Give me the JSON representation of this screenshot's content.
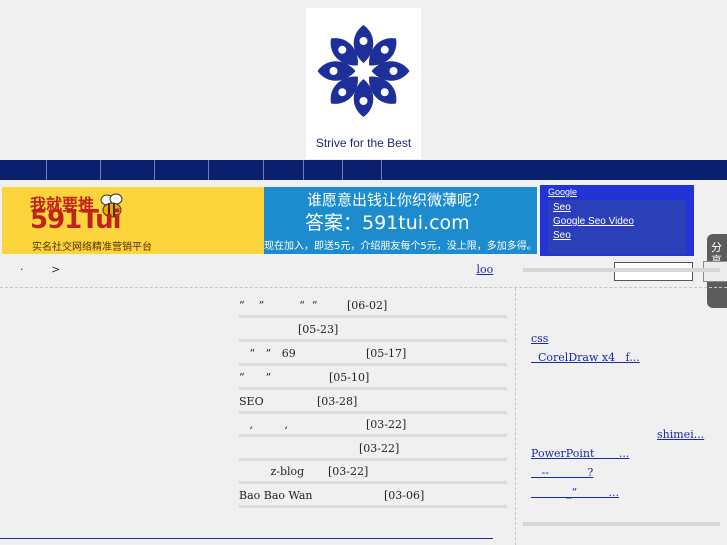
{
  "header": {
    "logo_tagline": "Strive for the Best"
  },
  "nav": {
    "items": [
      "",
      "",
      "",
      "",
      "",
      "",
      ""
    ]
  },
  "banner": {
    "slogan_cn": "我就要推",
    "brand": "591Tui",
    "sub_cn": "实名社交网络精准营销平台",
    "question": "谁愿意出钱让你织微薄呢？",
    "answer": "答案：591tui.com",
    "note": "现在加入，即送5元，介绍朋友每个5元，没上限，多加多得。"
  },
  "google_box": {
    "title": "Google",
    "links": [
      "Seo",
      "Google Seo Video",
      "Seo"
    ]
  },
  "share": {
    "label": "分享到："
  },
  "breadcrumb": {
    "dot": "·",
    "arrow": ">"
  },
  "tools": {
    "links": [
      "",
      "loo",
      "",
      "",
      ""
    ]
  },
  "search": {
    "value": "",
    "button_label": ""
  },
  "articles": [
    {
      "title": "“    ”          “  ”",
      "date": "[06-02]"
    },
    {
      "title": "",
      "date": "[05-23]"
    },
    {
      "title": "   “   ”   69",
      "date": "[05-17]"
    },
    {
      "title": "“      ”",
      "date": "[05-10]"
    },
    {
      "title": "SEO",
      "date": "[03-28]"
    },
    {
      "title": "   ,         ,",
      "date": "[03-22]"
    },
    {
      "title": "",
      "date": "[03-22]"
    },
    {
      "title": "         z-blog",
      "date": "[03-22]"
    },
    {
      "title": "Bao Bao Wan",
      "date": "[03-06]"
    }
  ],
  "sidebar": {
    "lines": [
      "css",
      "  CorelDraw x4   f...",
      "",
      "",
      "",
      "",
      "shimei...",
      "PowerPoint       ...",
      "   --           ?",
      "          _“         ...",
      ""
    ]
  }
}
